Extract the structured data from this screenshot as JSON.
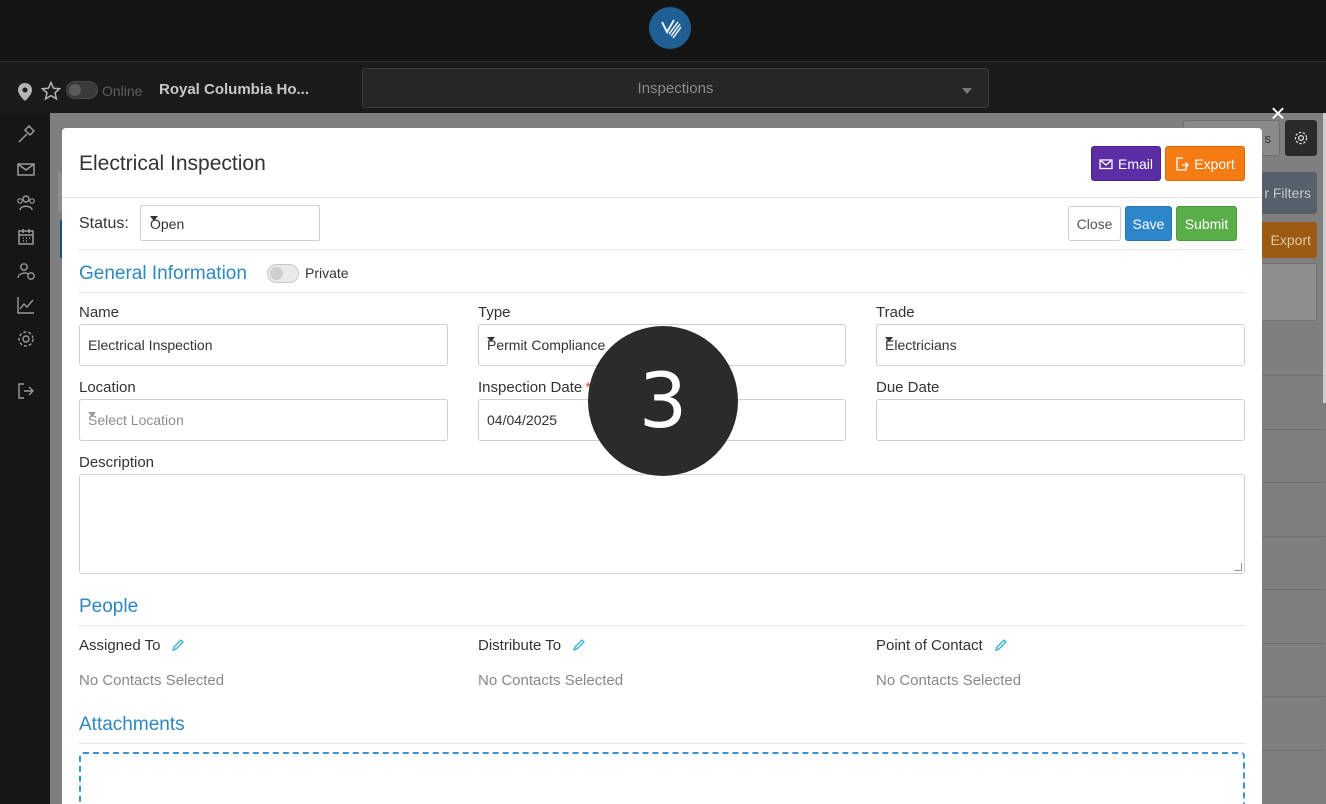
{
  "topbar": {
    "logo_icon": "company-logo-icon"
  },
  "subbar": {
    "online_label": "Online",
    "project_name": "Royal Columbia Ho...",
    "module_select": "Inspections"
  },
  "rail": {
    "icons": [
      "hammer-icon",
      "mail-icon",
      "users-icon",
      "calendar-icon",
      "user-clock-icon",
      "chart-icon",
      "gear-icon",
      "logout-icon"
    ]
  },
  "background": {
    "filters_label": "r Filters",
    "export_label": "Export",
    "views_label": "s"
  },
  "modal": {
    "title": "Electrical Inspection",
    "email_label": "Email",
    "export_label": "Export",
    "status_label": "Status:",
    "status_value": "Open",
    "close_label": "Close",
    "save_label": "Save",
    "submit_label": "Submit",
    "general_title": "General Information",
    "private_label": "Private",
    "fields": {
      "name_label": "Name",
      "name_value": "Electrical Inspection",
      "type_label": "Type",
      "type_value": "Permit Compliance",
      "trade_label": "Trade",
      "trade_value": "Electricians",
      "location_label": "Location",
      "location_placeholder": "Select Location",
      "inspection_date_label": "Inspection Date",
      "inspection_date_required": "*",
      "inspection_date_value": "04/04/2025",
      "due_date_label": "Due Date",
      "due_date_value": "",
      "description_label": "Description",
      "description_value": ""
    },
    "people_title": "People",
    "people": {
      "assigned_label": "Assigned To",
      "distribute_label": "Distribute To",
      "contact_label": "Point of Contact",
      "empty_text": "No Contacts Selected"
    },
    "attachments_title": "Attachments"
  },
  "overlay": {
    "step_number": "3"
  },
  "colors": {
    "accent_blue": "#2d87c3",
    "email_purple": "#5b2ea6",
    "export_orange": "#f57c12",
    "save_blue": "#2d86c9",
    "submit_green": "#5aae4a"
  }
}
